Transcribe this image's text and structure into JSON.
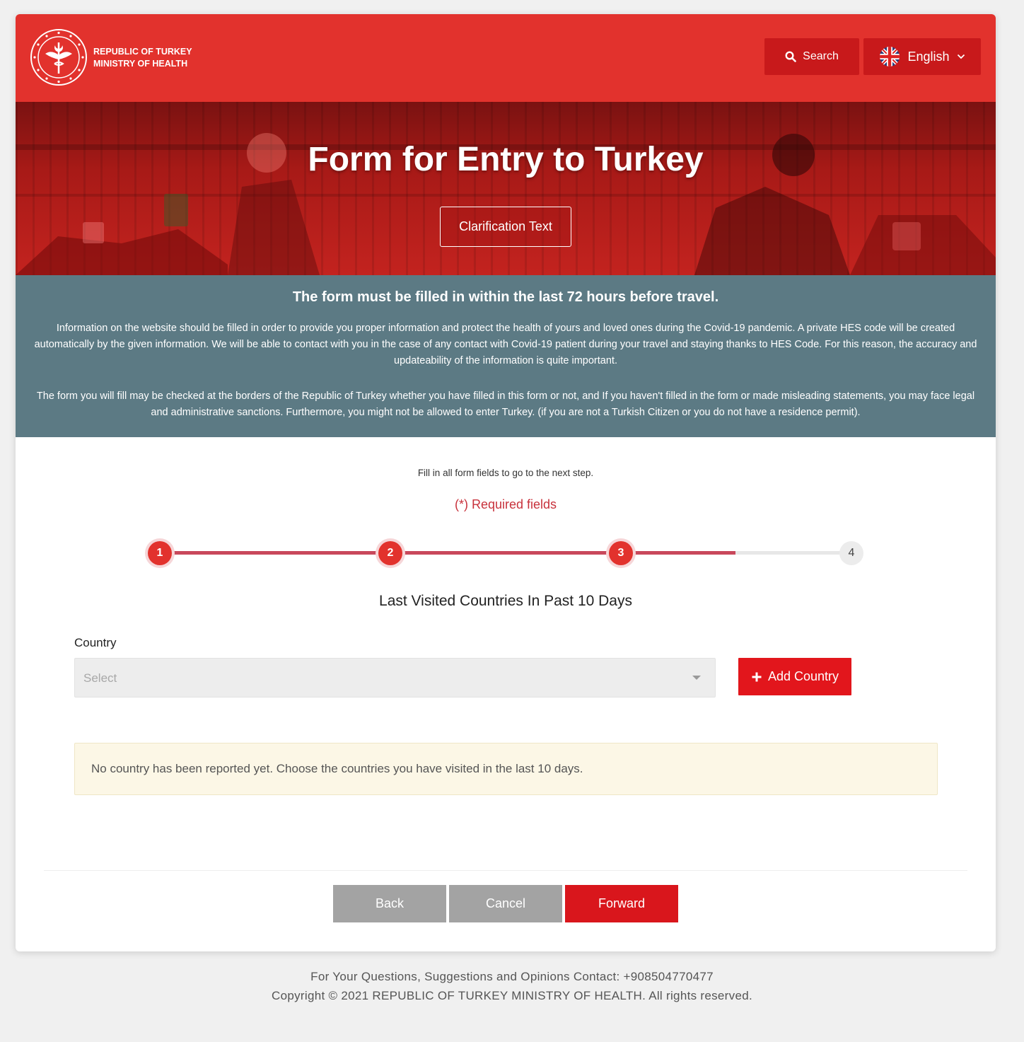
{
  "header": {
    "org_line1": "REPUBLIC OF TURKEY",
    "org_line2": "MINISTRY OF HEALTH",
    "logo_icon": "ministry-emblem-icon",
    "search_label": "Search",
    "language_label": "English",
    "brand_color": "#e2322d"
  },
  "hero": {
    "title": "Form for Entry to Turkey",
    "clarification_label": "Clarification Text"
  },
  "notice": {
    "heading": "The form must be filled in within the last 72 hours before travel.",
    "paragraph1": "Information on the website should be filled in order to provide you proper information and protect the health of yours and loved ones during the Covid-19 pandemic. A private HES code will be created automatically by the given information. We will be able to contact with you in the case of any contact with Covid-19 patient during your travel and staying thanks to HES Code. For this reason, the accuracy and updateability of the information is quite important.",
    "paragraph2": "The form you will fill may be checked at the borders of the Republic of Turkey whether you have filled in this form or not, and If you haven't filled in the form or made misleading statements, you may face legal and administrative sanctions. Furthermore, you might not be allowed to enter Turkey. (if you are not a Turkish Citizen or you do not have a residence permit).",
    "bg_color": "#5c7a84"
  },
  "form": {
    "hint": "Fill in all form fields to go to the next step.",
    "required_note": "(*) Required fields",
    "steps": [
      "1",
      "2",
      "3",
      "4"
    ],
    "current_step": 3,
    "section_title": "Last Visited Countries In Past 10 Days",
    "country_label": "Country",
    "country_placeholder": "Select",
    "add_country_label": "Add Country",
    "empty_message": "No country has been reported yet. Choose the countries you have visited in the last 10 days."
  },
  "actions": {
    "back_label": "Back",
    "cancel_label": "Cancel",
    "forward_label": "Forward"
  },
  "footer": {
    "contact": "For Your Questions, Suggestions and Opinions Contact: +908504770477",
    "copyright": "Copyright © 2021 REPUBLIC OF TURKEY MINISTRY OF HEALTH. All rights reserved."
  }
}
